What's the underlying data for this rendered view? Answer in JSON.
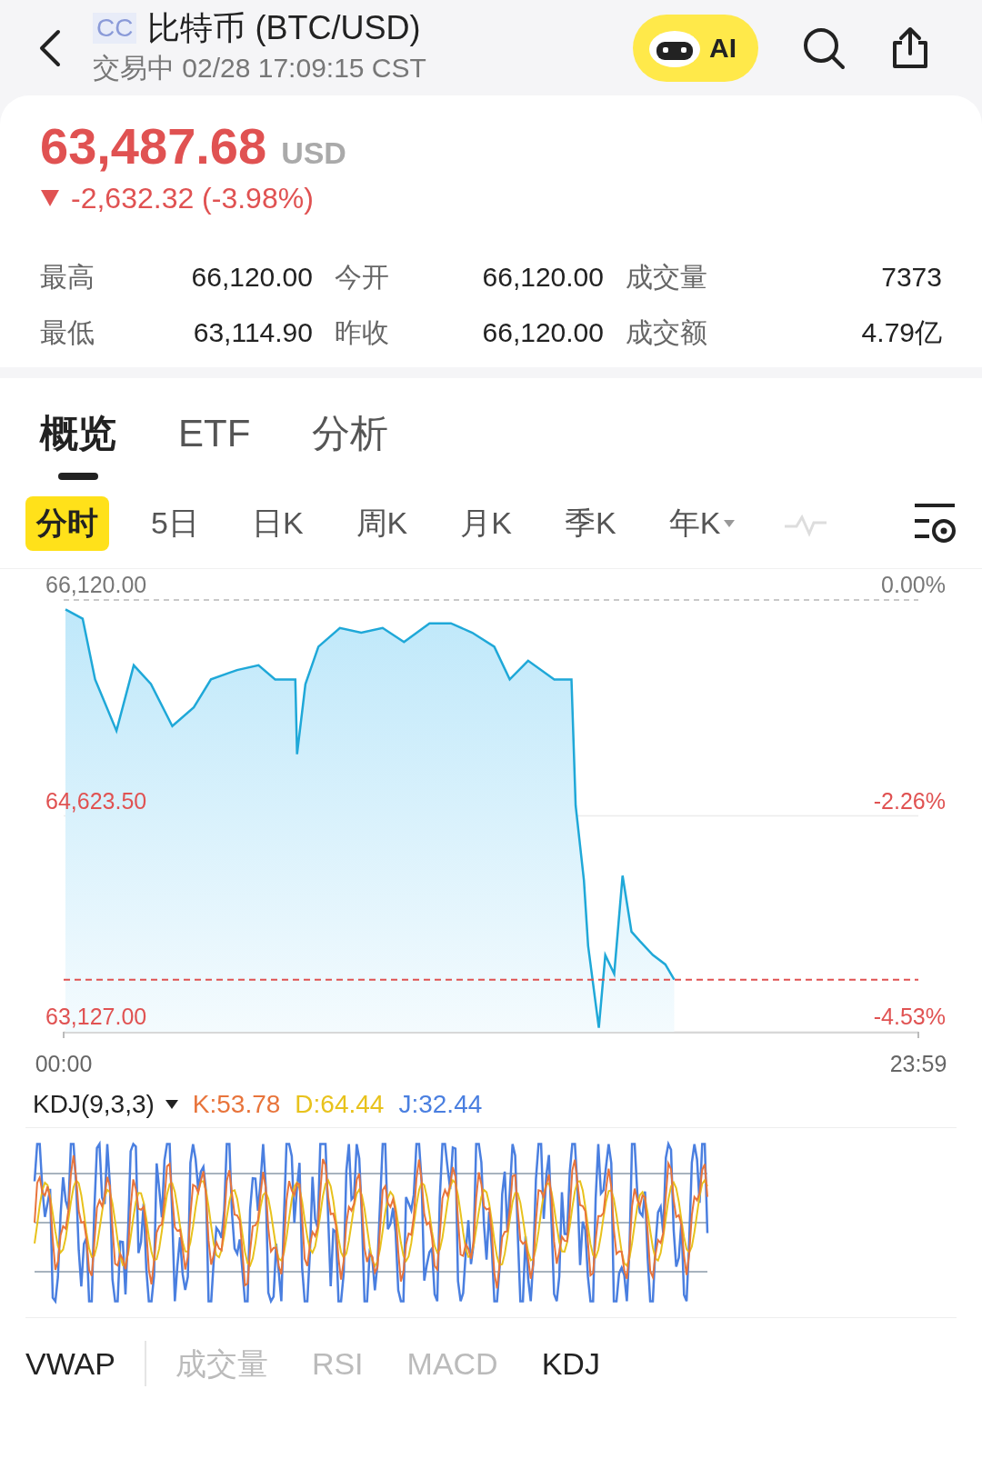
{
  "header": {
    "badge": "CC",
    "title": "比特币 (BTC/USD)",
    "status": "交易中 02/28 17:09:15 CST",
    "ai_button": "AI"
  },
  "quote": {
    "price": "63,487.68",
    "currency": "USD",
    "falling": true,
    "change": "-2,632.32 (-3.98%)"
  },
  "stats": [
    {
      "label": "最高",
      "value": "66,120.00"
    },
    {
      "label": "今开",
      "value": "66,120.00"
    },
    {
      "label": "成交量",
      "value": "7373"
    },
    {
      "label": "最低",
      "value": "63,114.90"
    },
    {
      "label": "昨收",
      "value": "66,120.00"
    },
    {
      "label": "成交额",
      "value": "4.79亿"
    }
  ],
  "main_tabs": [
    {
      "label": "概览",
      "selected": true
    },
    {
      "label": "ETF",
      "selected": false
    },
    {
      "label": "分析",
      "selected": false
    }
  ],
  "period_tabs": [
    {
      "label": "分时",
      "selected": true,
      "dropdown": false
    },
    {
      "label": "5日",
      "selected": false,
      "dropdown": false
    },
    {
      "label": "日K",
      "selected": false,
      "dropdown": false
    },
    {
      "label": "周K",
      "selected": false,
      "dropdown": false
    },
    {
      "label": "月K",
      "selected": false,
      "dropdown": false
    },
    {
      "label": "季K",
      "selected": false,
      "dropdown": false
    },
    {
      "label": "年K",
      "selected": false,
      "dropdown": true
    }
  ],
  "chart": {
    "right_labels": [
      "0.00%",
      "-2.26%",
      "-4.53%"
    ],
    "chart_data": {
      "type": "area",
      "x": [
        3,
        32,
        53,
        89,
        118,
        147,
        183,
        219,
        248,
        292,
        328,
        356,
        390,
        393,
        407,
        429,
        465,
        501,
        537,
        573,
        616,
        652,
        688,
        725,
        751,
        782,
        826,
        855,
        862,
        876,
        883,
        901,
        912,
        927,
        941,
        956,
        970,
        992,
        1013,
        1028
      ],
      "series": [
        {
          "color": "#1fa8d8",
          "values": [
            66055,
            65990,
            65569,
            65213,
            65667,
            65537,
            65246,
            65375,
            65569,
            65634,
            65667,
            65569,
            65569,
            65051,
            65537,
            65796,
            65926,
            65893,
            65926,
            65829,
            65958,
            65958,
            65893,
            65796,
            65569,
            65699,
            65569,
            65569,
            64695,
            64177,
            63724,
            63154,
            63659,
            63529,
            64209,
            63821,
            63756,
            63659,
            63594,
            63488
          ]
        }
      ],
      "xlim": [
        0,
        1439
      ],
      "ylim": [
        63127,
        66120
      ],
      "xticks": [
        {
          "value": 0,
          "label": "00:00"
        },
        {
          "value": 1439,
          "label": "23:59"
        }
      ],
      "yticks": [
        {
          "value": 66120,
          "label": "66,120.00"
        },
        {
          "value": 64623.5,
          "label": "64,623.50"
        },
        {
          "value": 63127,
          "label": "63,127.00"
        }
      ],
      "ref_lines": [
        {
          "axis": "y",
          "value": 63488
        }
      ]
    }
  },
  "kdj": {
    "label": "KDJ(9,3,3)",
    "readings": [
      {
        "text": "K:53.78",
        "color": "#e8743b"
      },
      {
        "text": "D:64.44",
        "color": "#e8c21c"
      },
      {
        "text": "J:32.44",
        "color": "#4a7fe0"
      }
    ]
  },
  "indicator_tabs": [
    {
      "label": "VWAP",
      "selected": true
    },
    {
      "label": "成交量",
      "selected": false
    },
    {
      "label": "RSI",
      "selected": false
    },
    {
      "label": "MACD",
      "selected": false
    },
    {
      "label": "KDJ",
      "selected": true
    }
  ]
}
